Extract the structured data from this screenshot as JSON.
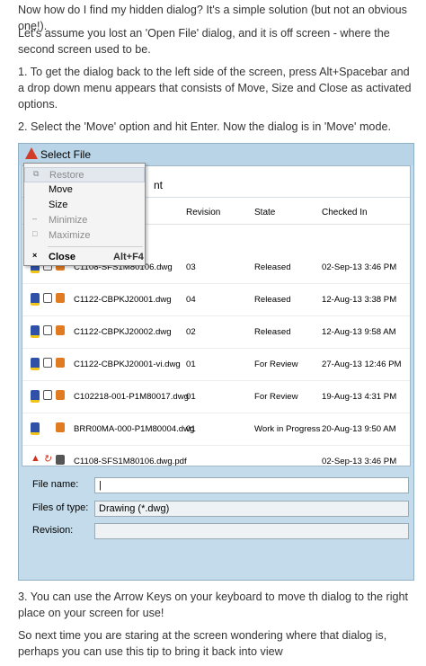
{
  "article": {
    "p1": "Now how do I find my hidden dialog? It's a simple solution (but not an obvious one!).",
    "p2": "Let's assume you lost an 'Open File' dialog, and it is off screen - where the second screen used to be.",
    "p3": "1. To get the dialog back to the left side of the screen, press Alt+Spacebar and a drop down menu appears that consists of Move, Size and Close as activated options.",
    "p4": "2. Select the 'Move' option and hit Enter.  Now the dialog is in 'Move' mode.",
    "p5": "3. You can use the Arrow Keys on your keyboard to move th dialog to the right place on your screen for use!",
    "p6": "So next time you are staring at the screen wondering where that dialog is, perhaps you can use this tip to bring it back into view"
  },
  "dialog": {
    "title": "Select File",
    "path_fragment": "nt",
    "columns": {
      "revision": "Revision",
      "state": "State",
      "checked_in": "Checked In"
    },
    "rows": [
      {
        "name": "C1108-SFS1M80106.dwg",
        "revision": "03",
        "state": "Released",
        "checked_in": "02-Sep-13 3:46 PM"
      },
      {
        "name": "C1122-CBPKJ20001.dwg",
        "revision": "04",
        "state": "Released",
        "checked_in": "12-Aug-13 3:38 PM"
      },
      {
        "name": "C1122-CBPKJ20002.dwg",
        "revision": "02",
        "state": "Released",
        "checked_in": "12-Aug-13 9:58 AM"
      },
      {
        "name": "C1122-CBPKJ20001-vi.dwg",
        "revision": "01",
        "state": "For Review",
        "checked_in": "27-Aug-13 12:46 PM"
      },
      {
        "name": "C102218-001-P1M80017.dwg",
        "revision": "01",
        "state": "For Review",
        "checked_in": "19-Aug-13 4:31 PM"
      },
      {
        "name": "BRR00MA-000-P1M80004.dwg",
        "revision": "01",
        "state": "Work in Progress",
        "checked_in": "20-Aug-13 9:50 AM"
      },
      {
        "name": "C1108-SFS1M80106.dwg.pdf",
        "revision": "",
        "state": "",
        "checked_in": "02-Sep-13 3:46 PM"
      }
    ],
    "file_name_label": "File name:",
    "file_name_value": "|",
    "files_of_type_label": "Files of type:",
    "files_of_type_value": "Drawing (*.dwg)",
    "revision_label": "Revision:",
    "revision_value": ""
  },
  "menu": {
    "restore": "Restore",
    "move": "Move",
    "size": "Size",
    "minimize": "Minimize",
    "maximize": "Maximize",
    "close": "Close",
    "close_shortcut": "Alt+F4"
  },
  "icons": {
    "title": "autocad-icon",
    "restore": "restore-icon",
    "minimize": "minimize-icon",
    "maximize": "maximize-icon",
    "close": "close-icon"
  },
  "colors": {
    "accent": "#d23b2a",
    "dialog_frame": "#c3dbea"
  }
}
